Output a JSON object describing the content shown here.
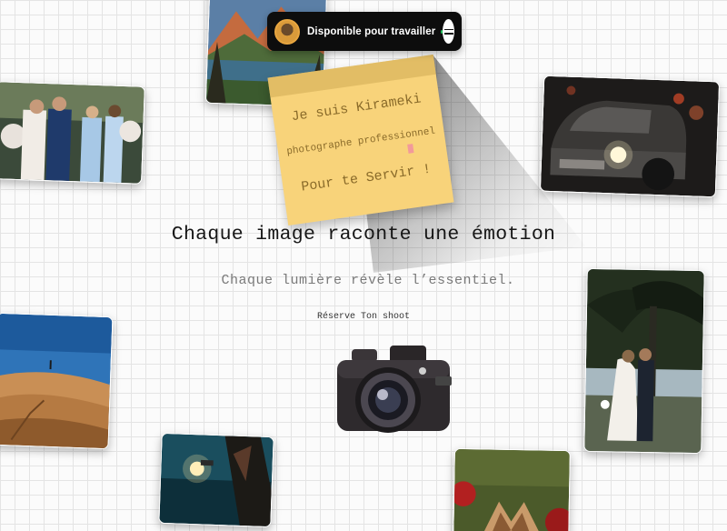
{
  "status": {
    "label": "Disponible pour travailler",
    "indicator_color": "#22c55e",
    "avatar_icon": "avatar",
    "menu_icon": "hamburger-menu-icon"
  },
  "note": {
    "line1": "Je suis Kirameki",
    "line2": "photographe professionnel",
    "line3": "Pour te Servir !",
    "color": "#f8d37a"
  },
  "hero": {
    "headline": "Chaque image raconte une émotion",
    "subline": "Chaque lumière révèle l’essentiel.",
    "cta": "Réserve Ton shoot"
  },
  "gallery": [
    {
      "subject": "mountain-lake"
    },
    {
      "subject": "wedding-celebration"
    },
    {
      "subject": "vintage-car-night"
    },
    {
      "subject": "desert-dunes"
    },
    {
      "subject": "couple-palm-trees"
    },
    {
      "subject": "underwater-diver"
    },
    {
      "subject": "butterfly-macro"
    }
  ]
}
